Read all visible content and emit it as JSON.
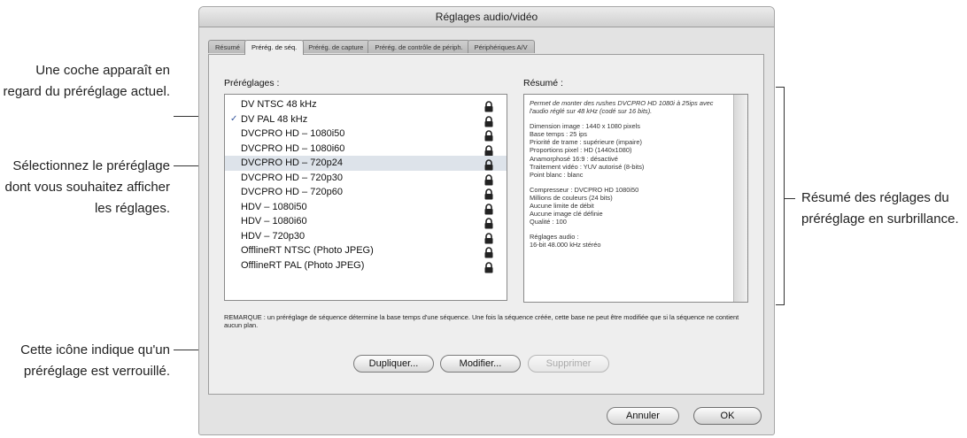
{
  "window": {
    "title": "Réglages audio/vidéo"
  },
  "tabs": [
    {
      "label": "Résumé"
    },
    {
      "label": "Prérég. de séq."
    },
    {
      "label": "Prérég. de capture"
    },
    {
      "label": "Prérég. de contrôle de périph."
    },
    {
      "label": "Périphériques A/V"
    }
  ],
  "active_tab": "Prérég. de séq.",
  "presets": {
    "heading": "Préréglages :",
    "items": [
      {
        "label": "DV NTSC 48 kHz",
        "current": false,
        "selected": false,
        "locked": true
      },
      {
        "label": "DV PAL 48 kHz",
        "current": true,
        "selected": false,
        "locked": true
      },
      {
        "label": "DVCPRO HD – 1080i50",
        "current": false,
        "selected": false,
        "locked": true
      },
      {
        "label": "DVCPRO HD – 1080i60",
        "current": false,
        "selected": false,
        "locked": true
      },
      {
        "label": "DVCPRO HD – 720p24",
        "current": false,
        "selected": true,
        "locked": true
      },
      {
        "label": "DVCPRO HD – 720p30",
        "current": false,
        "selected": false,
        "locked": true
      },
      {
        "label": "DVCPRO HD – 720p60",
        "current": false,
        "selected": false,
        "locked": true
      },
      {
        "label": "HDV – 1080i50",
        "current": false,
        "selected": false,
        "locked": true
      },
      {
        "label": "HDV – 1080i60",
        "current": false,
        "selected": false,
        "locked": true
      },
      {
        "label": "HDV – 720p30",
        "current": false,
        "selected": false,
        "locked": true
      },
      {
        "label": "OfflineRT NTSC (Photo JPEG)",
        "current": false,
        "selected": false,
        "locked": true
      },
      {
        "label": "OfflineRT PAL (Photo JPEG)",
        "current": false,
        "selected": false,
        "locked": true
      }
    ],
    "check_glyph": "✓",
    "lock_icon": "lock-icon"
  },
  "summary": {
    "heading": "Résumé :",
    "intro": "Permet de monter des rushes DVCPRO HD 1080i à 25ips avec l'audio réglé sur 48 kHz (codé sur 16 bits).",
    "block1": [
      "Dimension image : 1440 x 1080 pixels",
      "Base temps : 25 ips",
      "Priorité de trame : supérieure (impaire)",
      "Proportions pixel : HD (1440x1080)",
      "Anamorphosé 16:9 : désactivé",
      "Traitement vidéo : YUV autorisé (8-bits)",
      "Point blanc : blanc"
    ],
    "block2": [
      "Compresseur : DVCPRO HD 1080i50",
      "Millions de couleurs (24 bits)",
      "Aucune limite de débit",
      "Aucune image clé définie",
      "Qualité : 100"
    ],
    "block3": [
      "Réglages audio :",
      "16-bit 48.000 kHz stéréo"
    ]
  },
  "note": "REMARQUE : un préréglage de séquence détermine la base temps d'une séquence. Une fois la séquence créée, cette base ne peut être modifiée que si la séquence ne contient aucun plan.",
  "buttons": {
    "duplicate": "Dupliquer...",
    "edit": "Modifier...",
    "delete": "Supprimer",
    "cancel": "Annuler",
    "ok": "OK"
  },
  "callouts": {
    "checkmark": "Une coche apparaît en regard du préréglage actuel.",
    "select": "Sélectionnez le préréglage dont vous souhaitez afficher les réglages.",
    "lock": "Cette icône indique qu'un préréglage est verrouillé.",
    "summary": "Résumé des réglages du préréglage en surbrillance."
  }
}
